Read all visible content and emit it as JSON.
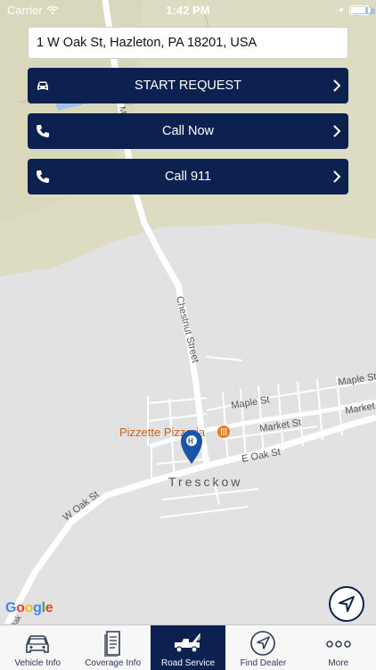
{
  "status_bar": {
    "carrier": "Carrier",
    "time": "1:42 PM"
  },
  "address": {
    "value": "1 W Oak St, Hazleton, PA 18201, USA"
  },
  "actions": [
    {
      "label": "START REQUEST",
      "icon": "car-icon"
    },
    {
      "label": "Call Now",
      "icon": "phone-icon"
    },
    {
      "label": "Call 911",
      "icon": "phone-icon"
    }
  ],
  "map": {
    "streets": [
      "Chestnut Street",
      "Maple St",
      "Maple St",
      "Market St",
      "Market",
      "E Oak St",
      "W Oak St",
      "Oak",
      "Mai"
    ],
    "poi": "Pizzette Pizzeria",
    "place": "Tresckow",
    "attribution": "Google",
    "pin_icon": "location-pin-icon"
  },
  "tab_bar": {
    "items": [
      {
        "label": "Vehicle Info",
        "icon": "car-outline-icon"
      },
      {
        "label": "Coverage Info",
        "icon": "document-icon"
      },
      {
        "label": "Road Service",
        "icon": "tow-truck-icon"
      },
      {
        "label": "Find Dealer",
        "icon": "navigation-icon"
      },
      {
        "label": "More",
        "icon": "more-dots-icon"
      }
    ],
    "active_index": 2
  },
  "colors": {
    "navy": "#0c2150",
    "map_ground": "#e2e2e2",
    "map_green": "#dcdcbf",
    "water": "#9fc3eb",
    "poi": "#e67d22"
  }
}
